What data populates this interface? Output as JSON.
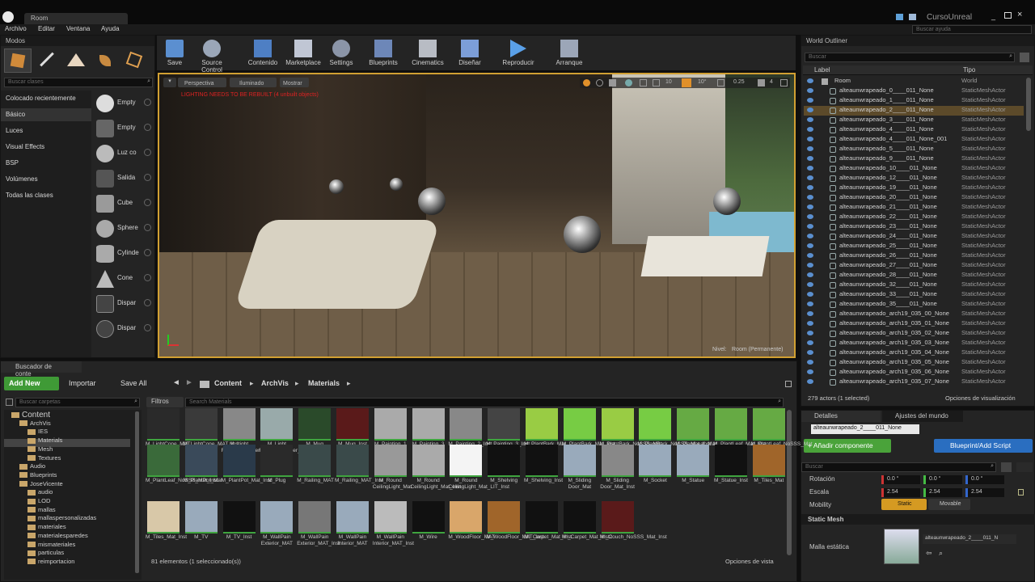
{
  "window": {
    "tab_title": "Room",
    "project_name": "CursoUnreal",
    "help_search_placeholder": "Buscar ayuda"
  },
  "menu": [
    "Archivo",
    "Editar",
    "Ventana",
    "Ayuda"
  ],
  "modes": {
    "tab": "Modos",
    "search_placeholder": "Buscar clases",
    "categories": [
      "Colocado recientemente",
      "Básico",
      "Luces",
      "Visual Effects",
      "BSP",
      "Volúmenes",
      "Todas las clases"
    ],
    "items": [
      "Empty",
      "Empty",
      "Luz co",
      "Salida",
      "Cube",
      "Sphere",
      "Cylinde",
      "Cone",
      "Dispar",
      "Dispar"
    ]
  },
  "toolbar": [
    "Save",
    "Source Control",
    "Contenido",
    "Marketplace",
    "Settings",
    "Blueprints",
    "Cinematics",
    "Diseñar",
    "Reproducir",
    "Arranque"
  ],
  "viewport": {
    "perspective": "Perspectiva",
    "lit": "Iluminado",
    "show": "Mostrar",
    "warning": "LIGHTING NEEDS TO BE REBUILT (4 unbuilt objects)",
    "grid": "10",
    "angle": "10°",
    "scale": "0.25",
    "cam": "4",
    "level_label": "Nivel:",
    "level_name": "Room (Permanente)"
  },
  "outliner": {
    "tab": "World Outliner",
    "search_placeholder": "Buscar",
    "col_label": "Label",
    "col_type": "Tipo",
    "root": {
      "name": "Room",
      "type": "World"
    },
    "rows": [
      {
        "name": "alteaunwrapeado_0____011_None",
        "type": "StaticMeshActor"
      },
      {
        "name": "alteaunwrapeado_1____011_None",
        "type": "StaticMeshActor"
      },
      {
        "name": "alteaunwrapeado_2____011_None",
        "type": "StaticMeshActor"
      },
      {
        "name": "alteaunwrapeado_3____011_None",
        "type": "StaticMeshActor"
      },
      {
        "name": "alteaunwrapeado_4____011_None",
        "type": "StaticMeshActor"
      },
      {
        "name": "alteaunwrapeado_4____011_None_001",
        "type": "StaticMeshActor"
      },
      {
        "name": "alteaunwrapeado_5____011_None",
        "type": "StaticMeshActor"
      },
      {
        "name": "alteaunwrapeado_9____011_None",
        "type": "StaticMeshActor"
      },
      {
        "name": "alteaunwrapeado_10____011_None",
        "type": "StaticMeshActor"
      },
      {
        "name": "alteaunwrapeado_12____011_None",
        "type": "StaticMeshActor"
      },
      {
        "name": "alteaunwrapeado_19____011_None",
        "type": "StaticMeshActor"
      },
      {
        "name": "alteaunwrapeado_20____011_None",
        "type": "StaticMeshActor"
      },
      {
        "name": "alteaunwrapeado_21____011_None",
        "type": "StaticMeshActor"
      },
      {
        "name": "alteaunwrapeado_22____011_None",
        "type": "StaticMeshActor"
      },
      {
        "name": "alteaunwrapeado_23____011_None",
        "type": "StaticMeshActor"
      },
      {
        "name": "alteaunwrapeado_24____011_None",
        "type": "StaticMeshActor"
      },
      {
        "name": "alteaunwrapeado_25____011_None",
        "type": "StaticMeshActor"
      },
      {
        "name": "alteaunwrapeado_26____011_None",
        "type": "StaticMeshActor"
      },
      {
        "name": "alteaunwrapeado_27____011_None",
        "type": "StaticMeshActor"
      },
      {
        "name": "alteaunwrapeado_28____011_None",
        "type": "StaticMeshActor"
      },
      {
        "name": "alteaunwrapeado_32____011_None",
        "type": "StaticMeshActor"
      },
      {
        "name": "alteaunwrapeado_33____011_None",
        "type": "StaticMeshActor"
      },
      {
        "name": "alteaunwrapeado_35____011_None",
        "type": "StaticMeshActor"
      },
      {
        "name": "alteaunwrapeado_arch19_035_00_None",
        "type": "StaticMeshActor"
      },
      {
        "name": "alteaunwrapeado_arch19_035_01_None",
        "type": "StaticMeshActor"
      },
      {
        "name": "alteaunwrapeado_arch19_035_02_None",
        "type": "StaticMeshActor"
      },
      {
        "name": "alteaunwrapeado_arch19_035_03_None",
        "type": "StaticMeshActor"
      },
      {
        "name": "alteaunwrapeado_arch19_035_04_None",
        "type": "StaticMeshActor"
      },
      {
        "name": "alteaunwrapeado_arch19_035_05_None",
        "type": "StaticMeshActor"
      },
      {
        "name": "alteaunwrapeado_arch19_035_06_None",
        "type": "StaticMeshActor"
      },
      {
        "name": "alteaunwrapeado_arch19_035_07_None",
        "type": "StaticMeshActor"
      }
    ],
    "status": "279 actors (1 selected)",
    "view_options": "Opciones de visualización"
  },
  "details": {
    "tab": "Detalles",
    "tab2": "Ajustes del mundo",
    "name_value": "alteaunwrapeado_2____011_None",
    "add_component": "+ Añadir componente",
    "blueprint": "Blueprint/Add Script",
    "search_placeholder": "Buscar",
    "rotation_label": "Rotación",
    "scale_label": "Escala",
    "mobility_label": "Mobility",
    "rot": [
      "0.0 °",
      "0.0 °",
      "0.0 °"
    ],
    "scale": [
      "2.54",
      "2.54",
      "2.54"
    ],
    "static": "Static",
    "movable": "Movable",
    "section": "Static Mesh",
    "mesh_label": "Malla estática",
    "mesh_value": "alteaunwrapeado_2____011_N"
  },
  "content": {
    "tab": "Buscador de conte",
    "add_new": "Add New",
    "import": "Importar",
    "save_all": "Save All",
    "path": [
      "Content",
      "ArchVis",
      "Materials"
    ],
    "folder_search": "Buscar carpetas",
    "filters": "Filtros",
    "search": "Search Materials",
    "count": "81 elementos (1 seleccionado(s))",
    "view_options": "Opciones de vista",
    "tree": [
      {
        "label": "Content",
        "indent": 0
      },
      {
        "label": "ArchVis",
        "indent": 1
      },
      {
        "label": "IES",
        "indent": 2
      },
      {
        "label": "Materials",
        "indent": 2
      },
      {
        "label": "Mesh",
        "indent": 2
      },
      {
        "label": "Textures",
        "indent": 2
      },
      {
        "label": "Audio",
        "indent": 1
      },
      {
        "label": "Blueprints",
        "indent": 1
      },
      {
        "label": "JoseVicente",
        "indent": 1
      },
      {
        "label": "audio",
        "indent": 2
      },
      {
        "label": "LOD",
        "indent": 2
      },
      {
        "label": "mallas",
        "indent": 2
      },
      {
        "label": "mallaspersonalizadas",
        "indent": 2
      },
      {
        "label": "materiales",
        "indent": 2
      },
      {
        "label": "materialesparedes",
        "indent": 2
      },
      {
        "label": "mismateriales",
        "indent": 2
      },
      {
        "label": "particulas",
        "indent": 2
      },
      {
        "label": "reimportacion",
        "indent": 2
      }
    ],
    "row1": [
      "M_LightCone_MAT",
      "M_LightCone_MAT_Inst",
      "M_Light Function_Flicker",
      "M_Light Function_Flicker_Inst",
      "M_Mug",
      "M_Mug_Inst",
      "M_Painting_1",
      "M_Painting_3",
      "M_Painting_2_Inst",
      "M_Painting_3_Inst",
      "M_PlantBark_Mat",
      "M_PlantBark_Mat_Inst",
      "M_PlantBark_NoSSS_Mat",
      "M_PlantBark_NoSSS_Mat_Inst",
      "M_PlantLeaf_Mat",
      "M_PlantLeaf_Mat_Inst",
      "M_PlantLeaf_NoSSS_Mat"
    ],
    "row2": [
      "M_PlantLeaf_NoSSS_Mat_Inst",
      "M_PlantPot_Mat",
      "M_PlantPot_Mat_Inst",
      "M_Plug",
      "M_Railing_MAT",
      "M_Railing_MAT_Inst",
      "M_Round CeilingLight_Mat",
      "M_Round CeilingLight_Mat_Inst",
      "M_Round CeilingLight_Mat_LIT_Inst",
      "M_Shelving",
      "M_Shelving_Inst",
      "M_Sliding Door_Mat",
      "M_Sliding Door_Mat_Inst",
      "M_Socket",
      "M_Statue",
      "M_Statue_Inst",
      "M_Tiles_Mat"
    ],
    "row3": [
      "M_Tiles_Mat_Inst",
      "M_TV",
      "M_TV_Inst",
      "M_WallPain Exterior_MAT",
      "M_WallPain Exterior_MAT_Inst",
      "M_WallPain Interior_MAT",
      "M_WallPain Interior_MAT_Inst",
      "M_Wire",
      "M_WoodFloor_MAT",
      "M_WoodFloor_MAT_Inst",
      "MI_Carpet_Mat_Inst",
      "MI_Carpet_Mat_Inst2",
      "MI_Couch_NoSSS_Mat_Inst"
    ]
  }
}
